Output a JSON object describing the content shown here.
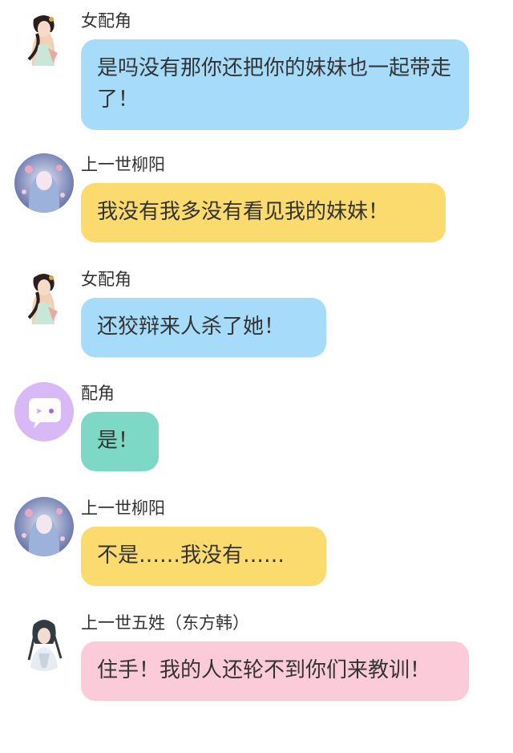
{
  "messages": [
    {
      "speaker": "女配角",
      "avatar": "female-costume-avatar-icon",
      "text": "是吗没有那你还把你的妹妹也一起带走了！",
      "bubble_color": "#a6dcfa"
    },
    {
      "speaker": "上一世柳阳",
      "avatar": "blue-floral-girl-avatar-icon",
      "text": "我没有我多没有看见我的妹妹！",
      "bubble_color": "#fcdb6e"
    },
    {
      "speaker": "女配角",
      "avatar": "female-costume-avatar-icon",
      "text": "还狡辩来人杀了她！",
      "bubble_color": "#a6dcfa"
    },
    {
      "speaker": "配角",
      "avatar": "purple-chat-bubble-avatar-icon",
      "text": "是！",
      "bubble_color": "#7dd8c6"
    },
    {
      "speaker": "上一世柳阳",
      "avatar": "blue-floral-girl-avatar-icon",
      "text": "不是……我没有……",
      "bubble_color": "#fcdb6e"
    },
    {
      "speaker": "上一世五姓（东方韩）",
      "avatar": "male-swordsman-avatar-icon",
      "text": "住手！我的人还轮不到你们来教训！",
      "bubble_color": "#fbcbd9"
    }
  ]
}
